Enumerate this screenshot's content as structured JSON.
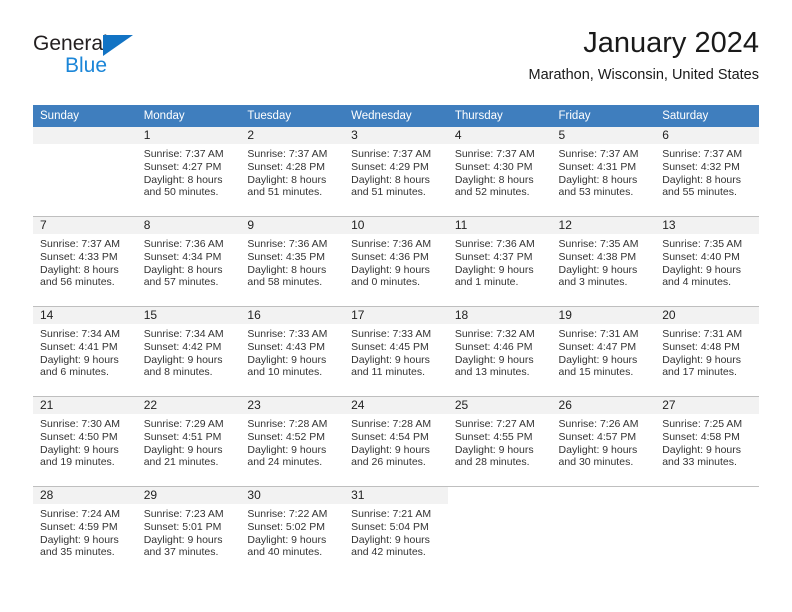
{
  "brand": {
    "name_part1": "General",
    "name_part2": "Blue",
    "triangle_color": "#1273c4"
  },
  "header": {
    "title": "January 2024",
    "subtitle": "Marathon, Wisconsin, United States"
  },
  "colors": {
    "header_blue": "#3f7ebe",
    "day_band_gray": "#f2f2f2",
    "grid_line": "#bfbfbf"
  },
  "weekday_headers": [
    "Sunday",
    "Monday",
    "Tuesday",
    "Wednesday",
    "Thursday",
    "Friday",
    "Saturday"
  ],
  "weeks": [
    [
      {
        "day": "",
        "sunrise": "",
        "sunset": "",
        "daylight1": "",
        "daylight2": ""
      },
      {
        "day": "1",
        "sunrise": "Sunrise: 7:37 AM",
        "sunset": "Sunset: 4:27 PM",
        "daylight1": "Daylight: 8 hours",
        "daylight2": "and 50 minutes."
      },
      {
        "day": "2",
        "sunrise": "Sunrise: 7:37 AM",
        "sunset": "Sunset: 4:28 PM",
        "daylight1": "Daylight: 8 hours",
        "daylight2": "and 51 minutes."
      },
      {
        "day": "3",
        "sunrise": "Sunrise: 7:37 AM",
        "sunset": "Sunset: 4:29 PM",
        "daylight1": "Daylight: 8 hours",
        "daylight2": "and 51 minutes."
      },
      {
        "day": "4",
        "sunrise": "Sunrise: 7:37 AM",
        "sunset": "Sunset: 4:30 PM",
        "daylight1": "Daylight: 8 hours",
        "daylight2": "and 52 minutes."
      },
      {
        "day": "5",
        "sunrise": "Sunrise: 7:37 AM",
        "sunset": "Sunset: 4:31 PM",
        "daylight1": "Daylight: 8 hours",
        "daylight2": "and 53 minutes."
      },
      {
        "day": "6",
        "sunrise": "Sunrise: 7:37 AM",
        "sunset": "Sunset: 4:32 PM",
        "daylight1": "Daylight: 8 hours",
        "daylight2": "and 55 minutes."
      }
    ],
    [
      {
        "day": "7",
        "sunrise": "Sunrise: 7:37 AM",
        "sunset": "Sunset: 4:33 PM",
        "daylight1": "Daylight: 8 hours",
        "daylight2": "and 56 minutes."
      },
      {
        "day": "8",
        "sunrise": "Sunrise: 7:36 AM",
        "sunset": "Sunset: 4:34 PM",
        "daylight1": "Daylight: 8 hours",
        "daylight2": "and 57 minutes."
      },
      {
        "day": "9",
        "sunrise": "Sunrise: 7:36 AM",
        "sunset": "Sunset: 4:35 PM",
        "daylight1": "Daylight: 8 hours",
        "daylight2": "and 58 minutes."
      },
      {
        "day": "10",
        "sunrise": "Sunrise: 7:36 AM",
        "sunset": "Sunset: 4:36 PM",
        "daylight1": "Daylight: 9 hours",
        "daylight2": "and 0 minutes."
      },
      {
        "day": "11",
        "sunrise": "Sunrise: 7:36 AM",
        "sunset": "Sunset: 4:37 PM",
        "daylight1": "Daylight: 9 hours",
        "daylight2": "and 1 minute."
      },
      {
        "day": "12",
        "sunrise": "Sunrise: 7:35 AM",
        "sunset": "Sunset: 4:38 PM",
        "daylight1": "Daylight: 9 hours",
        "daylight2": "and 3 minutes."
      },
      {
        "day": "13",
        "sunrise": "Sunrise: 7:35 AM",
        "sunset": "Sunset: 4:40 PM",
        "daylight1": "Daylight: 9 hours",
        "daylight2": "and 4 minutes."
      }
    ],
    [
      {
        "day": "14",
        "sunrise": "Sunrise: 7:34 AM",
        "sunset": "Sunset: 4:41 PM",
        "daylight1": "Daylight: 9 hours",
        "daylight2": "and 6 minutes."
      },
      {
        "day": "15",
        "sunrise": "Sunrise: 7:34 AM",
        "sunset": "Sunset: 4:42 PM",
        "daylight1": "Daylight: 9 hours",
        "daylight2": "and 8 minutes."
      },
      {
        "day": "16",
        "sunrise": "Sunrise: 7:33 AM",
        "sunset": "Sunset: 4:43 PM",
        "daylight1": "Daylight: 9 hours",
        "daylight2": "and 10 minutes."
      },
      {
        "day": "17",
        "sunrise": "Sunrise: 7:33 AM",
        "sunset": "Sunset: 4:45 PM",
        "daylight1": "Daylight: 9 hours",
        "daylight2": "and 11 minutes."
      },
      {
        "day": "18",
        "sunrise": "Sunrise: 7:32 AM",
        "sunset": "Sunset: 4:46 PM",
        "daylight1": "Daylight: 9 hours",
        "daylight2": "and 13 minutes."
      },
      {
        "day": "19",
        "sunrise": "Sunrise: 7:31 AM",
        "sunset": "Sunset: 4:47 PM",
        "daylight1": "Daylight: 9 hours",
        "daylight2": "and 15 minutes."
      },
      {
        "day": "20",
        "sunrise": "Sunrise: 7:31 AM",
        "sunset": "Sunset: 4:48 PM",
        "daylight1": "Daylight: 9 hours",
        "daylight2": "and 17 minutes."
      }
    ],
    [
      {
        "day": "21",
        "sunrise": "Sunrise: 7:30 AM",
        "sunset": "Sunset: 4:50 PM",
        "daylight1": "Daylight: 9 hours",
        "daylight2": "and 19 minutes."
      },
      {
        "day": "22",
        "sunrise": "Sunrise: 7:29 AM",
        "sunset": "Sunset: 4:51 PM",
        "daylight1": "Daylight: 9 hours",
        "daylight2": "and 21 minutes."
      },
      {
        "day": "23",
        "sunrise": "Sunrise: 7:28 AM",
        "sunset": "Sunset: 4:52 PM",
        "daylight1": "Daylight: 9 hours",
        "daylight2": "and 24 minutes."
      },
      {
        "day": "24",
        "sunrise": "Sunrise: 7:28 AM",
        "sunset": "Sunset: 4:54 PM",
        "daylight1": "Daylight: 9 hours",
        "daylight2": "and 26 minutes."
      },
      {
        "day": "25",
        "sunrise": "Sunrise: 7:27 AM",
        "sunset": "Sunset: 4:55 PM",
        "daylight1": "Daylight: 9 hours",
        "daylight2": "and 28 minutes."
      },
      {
        "day": "26",
        "sunrise": "Sunrise: 7:26 AM",
        "sunset": "Sunset: 4:57 PM",
        "daylight1": "Daylight: 9 hours",
        "daylight2": "and 30 minutes."
      },
      {
        "day": "27",
        "sunrise": "Sunrise: 7:25 AM",
        "sunset": "Sunset: 4:58 PM",
        "daylight1": "Daylight: 9 hours",
        "daylight2": "and 33 minutes."
      }
    ],
    [
      {
        "day": "28",
        "sunrise": "Sunrise: 7:24 AM",
        "sunset": "Sunset: 4:59 PM",
        "daylight1": "Daylight: 9 hours",
        "daylight2": "and 35 minutes."
      },
      {
        "day": "29",
        "sunrise": "Sunrise: 7:23 AM",
        "sunset": "Sunset: 5:01 PM",
        "daylight1": "Daylight: 9 hours",
        "daylight2": "and 37 minutes."
      },
      {
        "day": "30",
        "sunrise": "Sunrise: 7:22 AM",
        "sunset": "Sunset: 5:02 PM",
        "daylight1": "Daylight: 9 hours",
        "daylight2": "and 40 minutes."
      },
      {
        "day": "31",
        "sunrise": "Sunrise: 7:21 AM",
        "sunset": "Sunset: 5:04 PM",
        "daylight1": "Daylight: 9 hours",
        "daylight2": "and 42 minutes."
      },
      {
        "day": "",
        "sunrise": "",
        "sunset": "",
        "daylight1": "",
        "daylight2": ""
      },
      {
        "day": "",
        "sunrise": "",
        "sunset": "",
        "daylight1": "",
        "daylight2": ""
      },
      {
        "day": "",
        "sunrise": "",
        "sunset": "",
        "daylight1": "",
        "daylight2": ""
      }
    ]
  ]
}
